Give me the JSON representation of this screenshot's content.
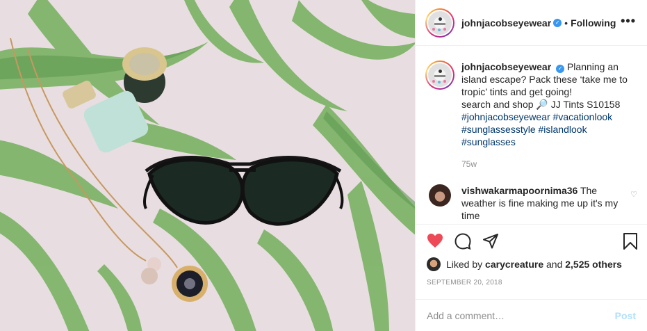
{
  "post": {
    "username": "johnjacobseyewear",
    "following_label": "Following",
    "separator": "•",
    "more_label": "•••",
    "verified_glyph": "✓",
    "caption": {
      "username": "johnjacobseyewear",
      "line1": "Planning an island escape? Pack these ‘take me to tropic’ tints and get going!",
      "line2_prefix": "search and shop",
      "search_emoji": "🔎",
      "line2_suffix": "JJ Tints S10158",
      "hashtags": [
        "#johnjacobseyewear",
        "#vacationlook",
        "#sunglassesstyle",
        "#islandlook",
        "#sunglasses"
      ]
    },
    "caption_time": "75w",
    "comment": {
      "username": "vishwakarmapoornima36",
      "text": "The weather is fine making me up it's my time"
    },
    "likes": {
      "prefix": "Liked by",
      "user": "carycreature",
      "and": "and",
      "count": "2,525 others"
    },
    "date": "SEPTEMBER 20, 2018",
    "add_comment_placeholder": "Add a comment…",
    "post_button": "Post"
  },
  "icons": {
    "like": "heart-icon",
    "comment": "comment-icon",
    "share": "share-icon",
    "save": "bookmark-icon"
  },
  "colors": {
    "heart_red": "#ed4956",
    "link_blue": "#00376b",
    "verified_blue": "#3897f0",
    "post_disabled": "#b2dffc"
  }
}
